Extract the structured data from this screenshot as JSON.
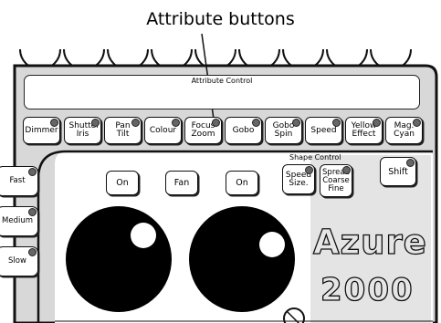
{
  "caption": "Attribute buttons",
  "display": {
    "label": "Attribute Control"
  },
  "attribute_buttons": [
    {
      "label": "Dimmer"
    },
    {
      "label": "Shutter Iris"
    },
    {
      "label": "Pan Tilt"
    },
    {
      "label": "Colour"
    },
    {
      "label": "Focus Zoom"
    },
    {
      "label": "Gobo"
    },
    {
      "label": "Gobo Spin"
    },
    {
      "label": "Speed"
    },
    {
      "label": "Yellow Effect"
    },
    {
      "label": "Mag. Cyan"
    }
  ],
  "speed_buttons": [
    {
      "label": "Fast"
    },
    {
      "label": "Medium"
    },
    {
      "label": "Slow"
    }
  ],
  "controls": {
    "on_1": "On",
    "fan": "Fan",
    "on_2": "On",
    "speed_size": "Speed Size.",
    "spread_coarse_fine": "Spread Coarse Fine",
    "shift": "Shift"
  },
  "shape_control_label": "Shape Control",
  "logo": {
    "name": "Azure",
    "model": "2000"
  },
  "colors": {
    "panel": "#d8d8d8",
    "outline": "#111111",
    "button": "#ffffff",
    "led": "#666666"
  }
}
